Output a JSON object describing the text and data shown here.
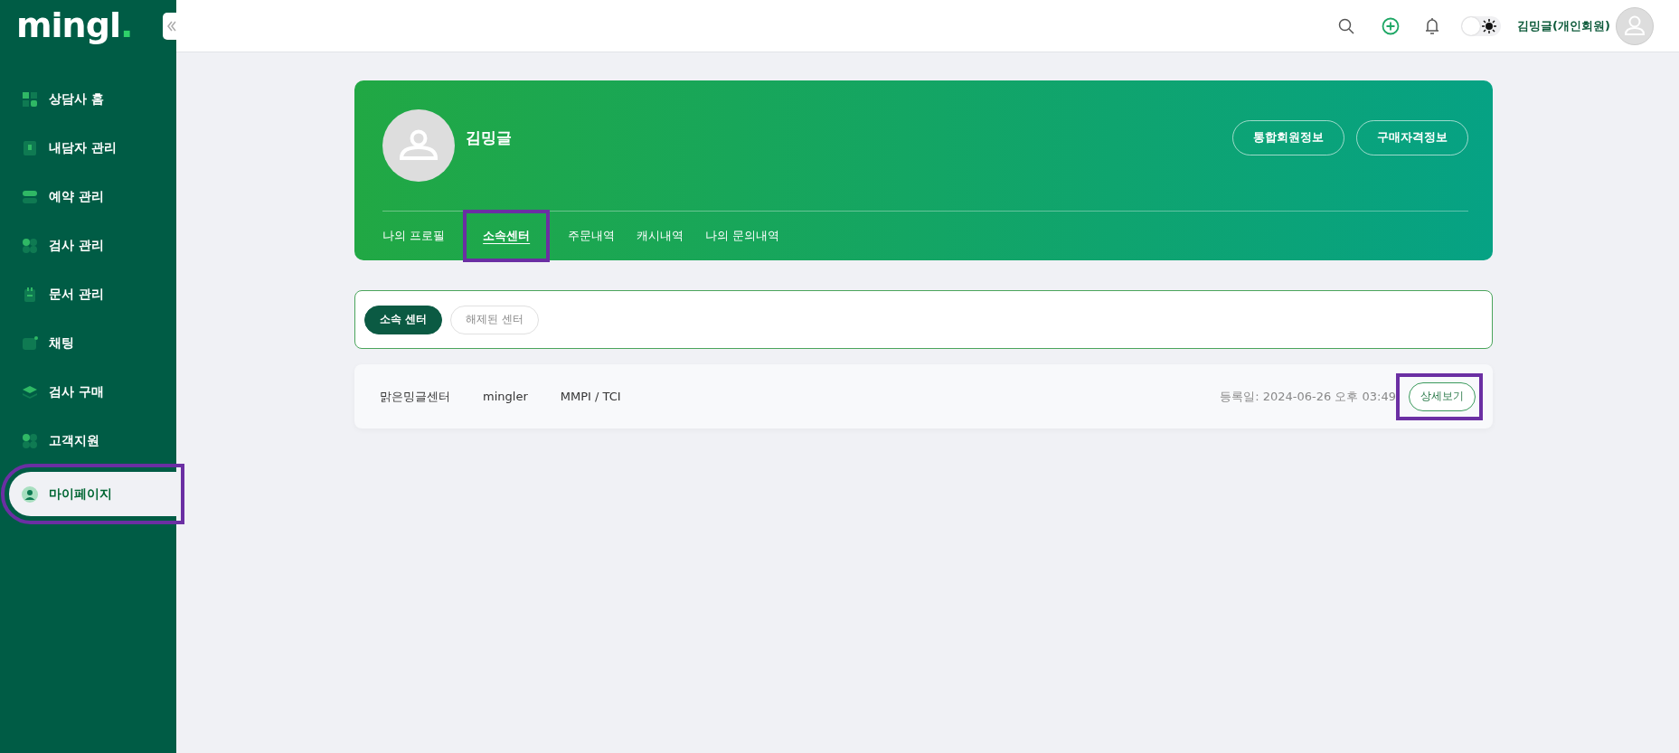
{
  "logo": {
    "text": "mingl",
    "dot": "."
  },
  "sidebar": {
    "items": [
      {
        "label": "상담사 홈",
        "selected": false,
        "highlighted": false
      },
      {
        "label": "내담자 관리",
        "selected": false,
        "highlighted": false
      },
      {
        "label": "예약 관리",
        "selected": false,
        "highlighted": false
      },
      {
        "label": "검사 관리",
        "selected": false,
        "highlighted": false
      },
      {
        "label": "문서 관리",
        "selected": false,
        "highlighted": false
      },
      {
        "label": "채팅",
        "selected": false,
        "highlighted": false
      },
      {
        "label": "검사 구매",
        "selected": false,
        "highlighted": false
      },
      {
        "label": "고객지원",
        "selected": false,
        "highlighted": false
      },
      {
        "label": "마이페이지",
        "selected": true,
        "highlighted": true
      }
    ]
  },
  "topbar": {
    "theme_toggle": {
      "on": false
    },
    "user_name": "김밍글(개인회원)"
  },
  "profile": {
    "name": "김밍글",
    "buttons": [
      "통합회원정보",
      "구매자격정보"
    ],
    "tabs": [
      {
        "label": "나의 프로필",
        "selected": false,
        "highlighted": false
      },
      {
        "label": "소속센터",
        "selected": true,
        "highlighted": true
      },
      {
        "label": "주문내역",
        "selected": false,
        "highlighted": false
      },
      {
        "label": "캐시내역",
        "selected": false,
        "highlighted": false
      },
      {
        "label": "나의 문의내역",
        "selected": false,
        "highlighted": false
      }
    ]
  },
  "filter": {
    "tabs": [
      {
        "label": "소속 센터",
        "selected": true
      },
      {
        "label": "해제된 센터",
        "selected": false
      }
    ]
  },
  "centers": [
    {
      "name": "맑은밍글센터",
      "user": "mingler",
      "tests": "MMPI / TCI",
      "registered": "등록일: 2024-06-26 오후 03:49",
      "action": "상세보기",
      "highlighted": true
    }
  ]
}
